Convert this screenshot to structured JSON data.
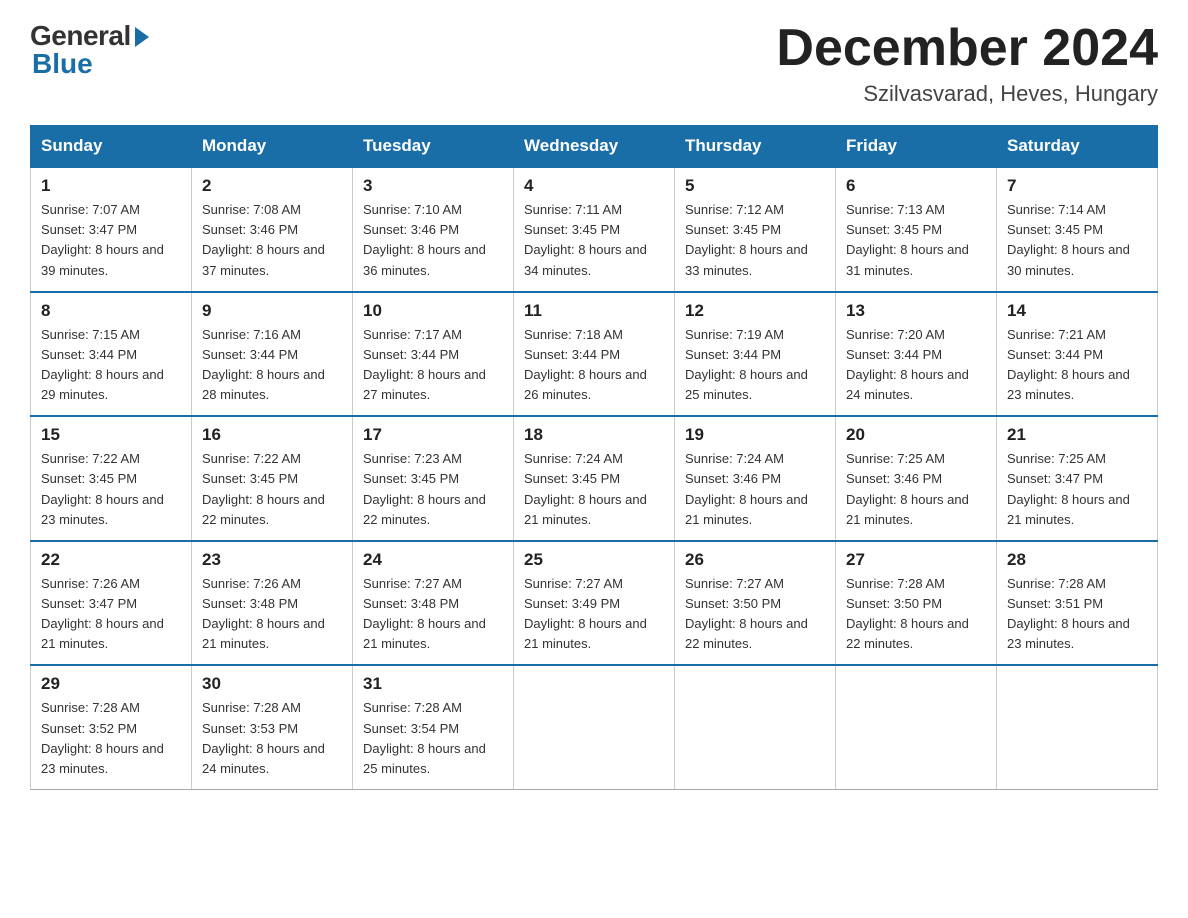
{
  "header": {
    "logo_general": "General",
    "logo_blue": "Blue",
    "month_title": "December 2024",
    "location": "Szilvasvarad, Heves, Hungary"
  },
  "days_of_week": [
    "Sunday",
    "Monday",
    "Tuesday",
    "Wednesday",
    "Thursday",
    "Friday",
    "Saturday"
  ],
  "weeks": [
    [
      {
        "num": "1",
        "sunrise": "7:07 AM",
        "sunset": "3:47 PM",
        "daylight": "8 hours and 39 minutes."
      },
      {
        "num": "2",
        "sunrise": "7:08 AM",
        "sunset": "3:46 PM",
        "daylight": "8 hours and 37 minutes."
      },
      {
        "num": "3",
        "sunrise": "7:10 AM",
        "sunset": "3:46 PM",
        "daylight": "8 hours and 36 minutes."
      },
      {
        "num": "4",
        "sunrise": "7:11 AM",
        "sunset": "3:45 PM",
        "daylight": "8 hours and 34 minutes."
      },
      {
        "num": "5",
        "sunrise": "7:12 AM",
        "sunset": "3:45 PM",
        "daylight": "8 hours and 33 minutes."
      },
      {
        "num": "6",
        "sunrise": "7:13 AM",
        "sunset": "3:45 PM",
        "daylight": "8 hours and 31 minutes."
      },
      {
        "num": "7",
        "sunrise": "7:14 AM",
        "sunset": "3:45 PM",
        "daylight": "8 hours and 30 minutes."
      }
    ],
    [
      {
        "num": "8",
        "sunrise": "7:15 AM",
        "sunset": "3:44 PM",
        "daylight": "8 hours and 29 minutes."
      },
      {
        "num": "9",
        "sunrise": "7:16 AM",
        "sunset": "3:44 PM",
        "daylight": "8 hours and 28 minutes."
      },
      {
        "num": "10",
        "sunrise": "7:17 AM",
        "sunset": "3:44 PM",
        "daylight": "8 hours and 27 minutes."
      },
      {
        "num": "11",
        "sunrise": "7:18 AM",
        "sunset": "3:44 PM",
        "daylight": "8 hours and 26 minutes."
      },
      {
        "num": "12",
        "sunrise": "7:19 AM",
        "sunset": "3:44 PM",
        "daylight": "8 hours and 25 minutes."
      },
      {
        "num": "13",
        "sunrise": "7:20 AM",
        "sunset": "3:44 PM",
        "daylight": "8 hours and 24 minutes."
      },
      {
        "num": "14",
        "sunrise": "7:21 AM",
        "sunset": "3:44 PM",
        "daylight": "8 hours and 23 minutes."
      }
    ],
    [
      {
        "num": "15",
        "sunrise": "7:22 AM",
        "sunset": "3:45 PM",
        "daylight": "8 hours and 23 minutes."
      },
      {
        "num": "16",
        "sunrise": "7:22 AM",
        "sunset": "3:45 PM",
        "daylight": "8 hours and 22 minutes."
      },
      {
        "num": "17",
        "sunrise": "7:23 AM",
        "sunset": "3:45 PM",
        "daylight": "8 hours and 22 minutes."
      },
      {
        "num": "18",
        "sunrise": "7:24 AM",
        "sunset": "3:45 PM",
        "daylight": "8 hours and 21 minutes."
      },
      {
        "num": "19",
        "sunrise": "7:24 AM",
        "sunset": "3:46 PM",
        "daylight": "8 hours and 21 minutes."
      },
      {
        "num": "20",
        "sunrise": "7:25 AM",
        "sunset": "3:46 PM",
        "daylight": "8 hours and 21 minutes."
      },
      {
        "num": "21",
        "sunrise": "7:25 AM",
        "sunset": "3:47 PM",
        "daylight": "8 hours and 21 minutes."
      }
    ],
    [
      {
        "num": "22",
        "sunrise": "7:26 AM",
        "sunset": "3:47 PM",
        "daylight": "8 hours and 21 minutes."
      },
      {
        "num": "23",
        "sunrise": "7:26 AM",
        "sunset": "3:48 PM",
        "daylight": "8 hours and 21 minutes."
      },
      {
        "num": "24",
        "sunrise": "7:27 AM",
        "sunset": "3:48 PM",
        "daylight": "8 hours and 21 minutes."
      },
      {
        "num": "25",
        "sunrise": "7:27 AM",
        "sunset": "3:49 PM",
        "daylight": "8 hours and 21 minutes."
      },
      {
        "num": "26",
        "sunrise": "7:27 AM",
        "sunset": "3:50 PM",
        "daylight": "8 hours and 22 minutes."
      },
      {
        "num": "27",
        "sunrise": "7:28 AM",
        "sunset": "3:50 PM",
        "daylight": "8 hours and 22 minutes."
      },
      {
        "num": "28",
        "sunrise": "7:28 AM",
        "sunset": "3:51 PM",
        "daylight": "8 hours and 23 minutes."
      }
    ],
    [
      {
        "num": "29",
        "sunrise": "7:28 AM",
        "sunset": "3:52 PM",
        "daylight": "8 hours and 23 minutes."
      },
      {
        "num": "30",
        "sunrise": "7:28 AM",
        "sunset": "3:53 PM",
        "daylight": "8 hours and 24 minutes."
      },
      {
        "num": "31",
        "sunrise": "7:28 AM",
        "sunset": "3:54 PM",
        "daylight": "8 hours and 25 minutes."
      },
      null,
      null,
      null,
      null
    ]
  ]
}
